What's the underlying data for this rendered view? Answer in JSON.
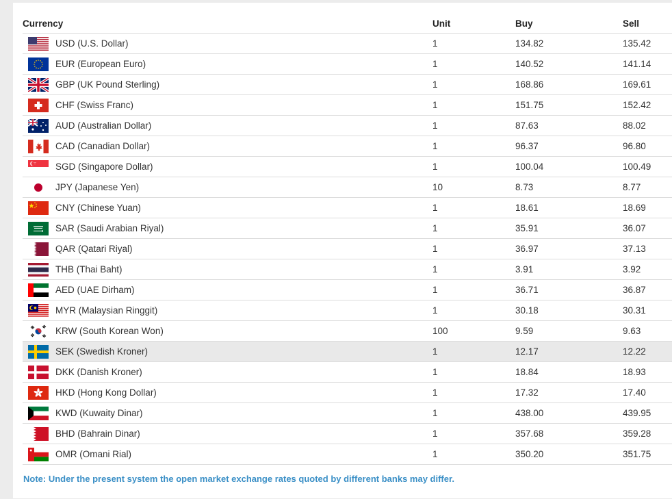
{
  "table": {
    "headers": {
      "currency": "Currency",
      "unit": "Unit",
      "buy": "Buy",
      "sell": "Sell"
    },
    "rows": [
      {
        "code": "usd",
        "name": "USD (U.S. Dollar)",
        "unit": "1",
        "buy": "134.82",
        "sell": "135.42",
        "flag_icon": "us-flag-icon"
      },
      {
        "code": "eur",
        "name": "EUR (European Euro)",
        "unit": "1",
        "buy": "140.52",
        "sell": "141.14",
        "flag_icon": "eu-flag-icon"
      },
      {
        "code": "gbp",
        "name": "GBP (UK Pound Sterling)",
        "unit": "1",
        "buy": "168.86",
        "sell": "169.61",
        "flag_icon": "uk-flag-icon"
      },
      {
        "code": "chf",
        "name": "CHF (Swiss Franc)",
        "unit": "1",
        "buy": "151.75",
        "sell": "152.42",
        "flag_icon": "swiss-flag-icon"
      },
      {
        "code": "aud",
        "name": "AUD (Australian Dollar)",
        "unit": "1",
        "buy": "87.63",
        "sell": "88.02",
        "flag_icon": "australia-flag-icon"
      },
      {
        "code": "cad",
        "name": "CAD (Canadian Dollar)",
        "unit": "1",
        "buy": "96.37",
        "sell": "96.80",
        "flag_icon": "canada-flag-icon"
      },
      {
        "code": "sgd",
        "name": "SGD (Singapore Dollar)",
        "unit": "1",
        "buy": "100.04",
        "sell": "100.49",
        "flag_icon": "singapore-flag-icon"
      },
      {
        "code": "jpy",
        "name": "JPY (Japanese Yen)",
        "unit": "10",
        "buy": "8.73",
        "sell": "8.77",
        "flag_icon": "japan-flag-icon"
      },
      {
        "code": "cny",
        "name": "CNY (Chinese Yuan)",
        "unit": "1",
        "buy": "18.61",
        "sell": "18.69",
        "flag_icon": "china-flag-icon"
      },
      {
        "code": "sar",
        "name": "SAR (Saudi Arabian Riyal)",
        "unit": "1",
        "buy": "35.91",
        "sell": "36.07",
        "flag_icon": "saudi-flag-icon"
      },
      {
        "code": "qar",
        "name": "QAR (Qatari Riyal)",
        "unit": "1",
        "buy": "36.97",
        "sell": "37.13",
        "flag_icon": "qatar-flag-icon"
      },
      {
        "code": "thb",
        "name": "THB (Thai Baht)",
        "unit": "1",
        "buy": "3.91",
        "sell": "3.92",
        "flag_icon": "thailand-flag-icon"
      },
      {
        "code": "aed",
        "name": "AED (UAE Dirham)",
        "unit": "1",
        "buy": "36.71",
        "sell": "36.87",
        "flag_icon": "uae-flag-icon"
      },
      {
        "code": "myr",
        "name": "MYR (Malaysian Ringgit)",
        "unit": "1",
        "buy": "30.18",
        "sell": "30.31",
        "flag_icon": "malaysia-flag-icon"
      },
      {
        "code": "krw",
        "name": "KRW (South Korean Won)",
        "unit": "100",
        "buy": "9.59",
        "sell": "9.63",
        "flag_icon": "south-korea-flag-icon"
      },
      {
        "code": "sek",
        "name": "SEK (Swedish Kroner)",
        "unit": "1",
        "buy": "12.17",
        "sell": "12.22",
        "flag_icon": "sweden-flag-icon"
      },
      {
        "code": "dkk",
        "name": "DKK (Danish Kroner)",
        "unit": "1",
        "buy": "18.84",
        "sell": "18.93",
        "flag_icon": "denmark-flag-icon"
      },
      {
        "code": "hkd",
        "name": "HKD (Hong Kong Dollar)",
        "unit": "1",
        "buy": "17.32",
        "sell": "17.40",
        "flag_icon": "hong-kong-flag-icon"
      },
      {
        "code": "kwd",
        "name": "KWD (Kuwaity Dinar)",
        "unit": "1",
        "buy": "438.00",
        "sell": "439.95",
        "flag_icon": "kuwait-flag-icon"
      },
      {
        "code": "bhd",
        "name": "BHD (Bahrain Dinar)",
        "unit": "1",
        "buy": "357.68",
        "sell": "359.28",
        "flag_icon": "bahrain-flag-icon"
      },
      {
        "code": "omr",
        "name": "OMR (Omani Rial)",
        "unit": "1",
        "buy": "350.20",
        "sell": "351.75",
        "flag_icon": "oman-flag-icon"
      }
    ],
    "highlighted_row": "sek"
  },
  "note": "Note: Under the present system the open market exchange rates quoted by different banks may differ.",
  "colors": {
    "note": "#3a8fc6",
    "row_highlight": "#e9e9e9",
    "row_border": "#dcdcdc"
  }
}
